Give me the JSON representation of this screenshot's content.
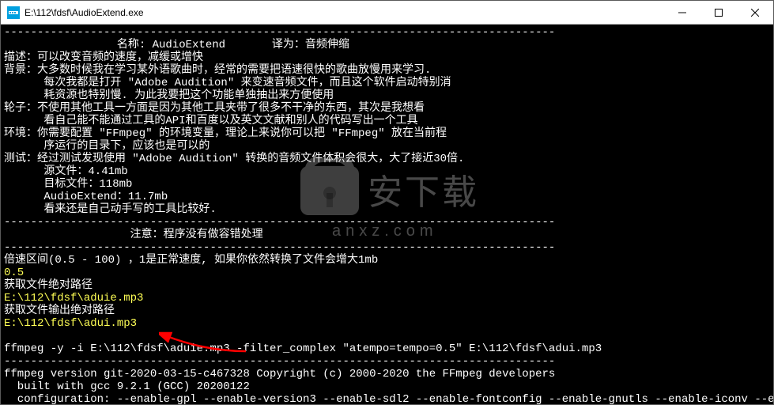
{
  "window": {
    "title": "E:\\112\\fdsf\\AudioExtend.exe"
  },
  "console": {
    "lines": [
      "-----------------------------------------------------------------------------------",
      "                 名称: AudioExtend       译为：音频伸缩",
      "描述：可以改变音频的速度，减缓或增快",
      "背景：大多数时候我在学习某外语歌曲时，经常的需要把语速很快的歌曲放慢用来学习.",
      "      每次我都是打开 \"Adobe Audition\" 来变速音频文件，而且这个软件启动特别消",
      "      耗资源也特别慢. 为此我要把这个功能单独抽出来方便使用",
      "轮子：不使用其他工具一方面是因为其他工具夹带了很多不干净的东西，其次是我想看",
      "      看自己能不能通过工具的API和百度以及英文文献和别人的代码写出一个工具",
      "环境：你需要配置 \"FFmpeg\" 的环境变量，理论上来说你可以把 \"FFmpeg\" 放在当前程",
      "      序运行的目录下，应该也是可以的",
      "测试：经过测试发现使用 \"Adobe Audition\" 转换的音频文件体积会很大，大了接近30倍.",
      "      源文件：4.41mb",
      "      目标文件：118mb",
      "      AudioExtend：11.7mb",
      "      看来还是自己动手写的工具比较好.",
      "-----------------------------------------------------------------------------------",
      "                   注意：程序没有做容错处理",
      "-----------------------------------------------------------------------------------",
      "倍速区间(0.5 - 100) ，1是正常速度, 如果你依然转换了文件会增大1mb"
    ],
    "input1": "0.5",
    "prompt1": "获取文件绝对路径",
    "path1": "E:\\112\\fdsf\\aduie.mp3",
    "prompt2": "获取文件输出绝对路径",
    "path2": "E:\\112\\fdsf\\adui.mp3",
    "blank": "",
    "cmd": "ffmpeg -y -i E:\\112\\fdsf\\aduie.mp3 -filter_complex \"atempo=tempo=0.5\" E:\\112\\fdsf\\adui.mp3",
    "sep": "-----------------------------------------------------------------------------------",
    "ff_ver": "ffmpeg version git-2020-03-15-c467328 Copyright (c) 2000-2020 the FFmpeg developers",
    "ff_built": "  built with gcc 9.2.1 (GCC) 20200122",
    "ff_conf": "  configuration: --enable-gpl --enable-version3 --enable-sdl2 --enable-fontconfig --enable-gnutls --enable-iconv --enabl"
  },
  "watermark": {
    "main": "安下载",
    "sub": "anxz.com"
  }
}
